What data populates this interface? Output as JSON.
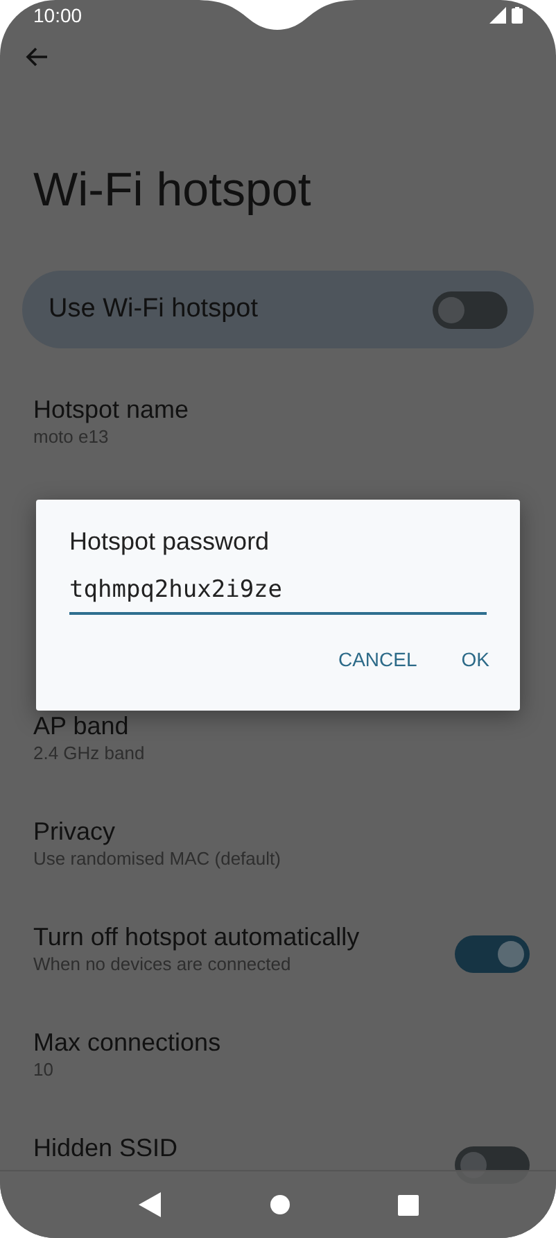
{
  "status_bar": {
    "time": "10:00"
  },
  "page": {
    "title": "Wi-Fi hotspot"
  },
  "main_switch": {
    "label": "Use Wi-Fi hotspot",
    "on": false
  },
  "settings": [
    {
      "title": "Hotspot name",
      "subtitle": "moto e13",
      "kind": "text"
    },
    {
      "kind": "hidden"
    },
    {
      "kind": "hidden"
    },
    {
      "title": "AP band",
      "subtitle": "2.4 GHz band",
      "kind": "text"
    },
    {
      "title": "Privacy",
      "subtitle": "Use randomised MAC (default)",
      "kind": "text"
    },
    {
      "title": "Turn off hotspot automatically",
      "subtitle": "When no devices are connected",
      "kind": "toggle",
      "on": true
    },
    {
      "title": "Max connections",
      "subtitle": "10",
      "kind": "text"
    },
    {
      "title": "Hidden SSID",
      "kind": "toggle",
      "on": false
    }
  ],
  "dialog": {
    "title": "Hotspot password",
    "value": "tqhmpq2hux2i9ze",
    "buttons": [
      "CANCEL",
      "OK"
    ]
  }
}
